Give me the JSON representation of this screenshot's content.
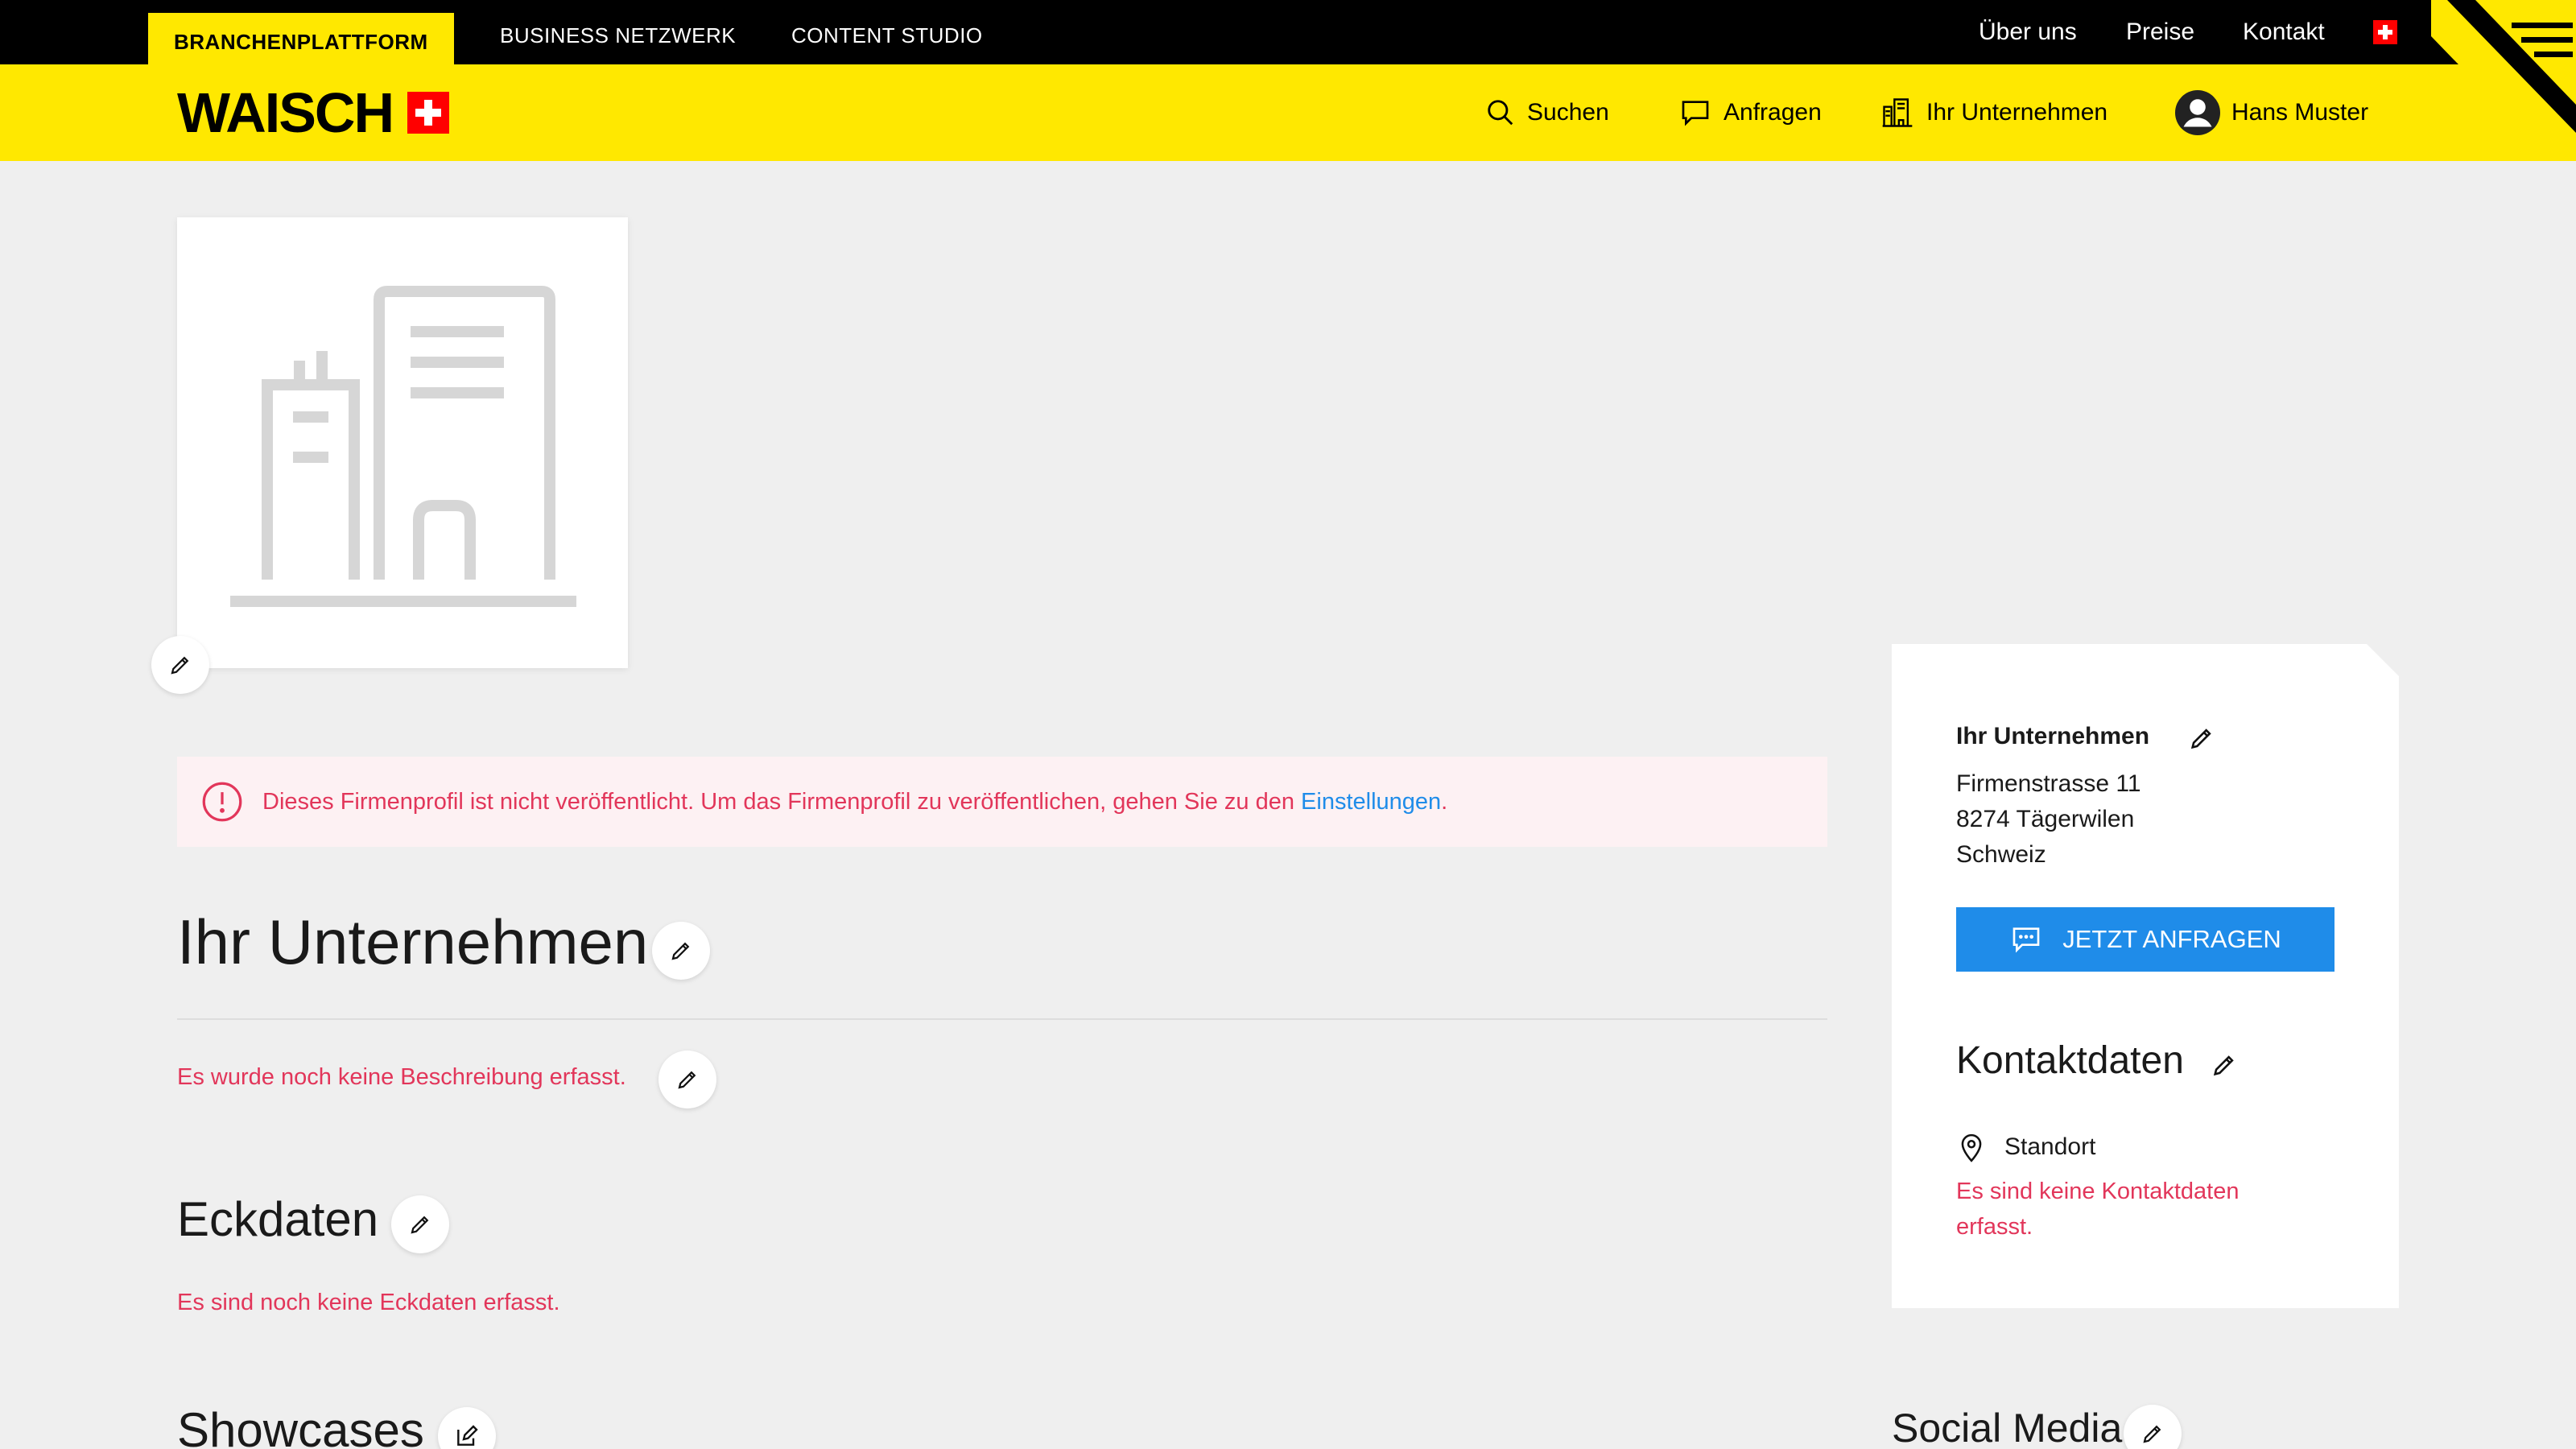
{
  "topbar": {
    "tabs": [
      "BRANCHENPLATTFORM",
      "BUSINESS NETZWERK",
      "CONTENT STUDIO"
    ],
    "links": [
      "Über uns",
      "Preise",
      "Kontakt"
    ]
  },
  "brand": {
    "name": "WAISCH",
    "accent": "#ffe800",
    "flag_color": "#ff0000"
  },
  "nav": {
    "search": "Suchen",
    "requests": "Anfragen",
    "company": "Ihr Unternehmen",
    "user": "Hans Muster"
  },
  "alert": {
    "text": "Dieses Firmenprofil ist nicht veröffentlicht. Um das Firmenprofil zu veröffentlichen, gehen Sie zu den ",
    "link": "Einstellungen",
    "end": "."
  },
  "profile": {
    "title": "Ihr Unternehmen",
    "no_description": "Es wurde noch keine Beschreibung erfasst.",
    "keydata_title": "Eckdaten",
    "no_keydata": "Es sind noch keine Eckdaten erfasst.",
    "showcases_title": "Showcases"
  },
  "sidebar": {
    "company": "Ihr Unternehmen",
    "street": "Firmenstrasse 11",
    "city": "8274 Tägerwilen",
    "country": "Schweiz",
    "cta": "JETZT ANFRAGEN",
    "contact_title": "Kontaktdaten",
    "location_label": "Standort",
    "no_contact": "Es sind keine Kontaktdaten erfasst.",
    "social_title": "Social Media"
  },
  "colors": {
    "primary": "#1f8ce9",
    "error": "#e2365a"
  }
}
